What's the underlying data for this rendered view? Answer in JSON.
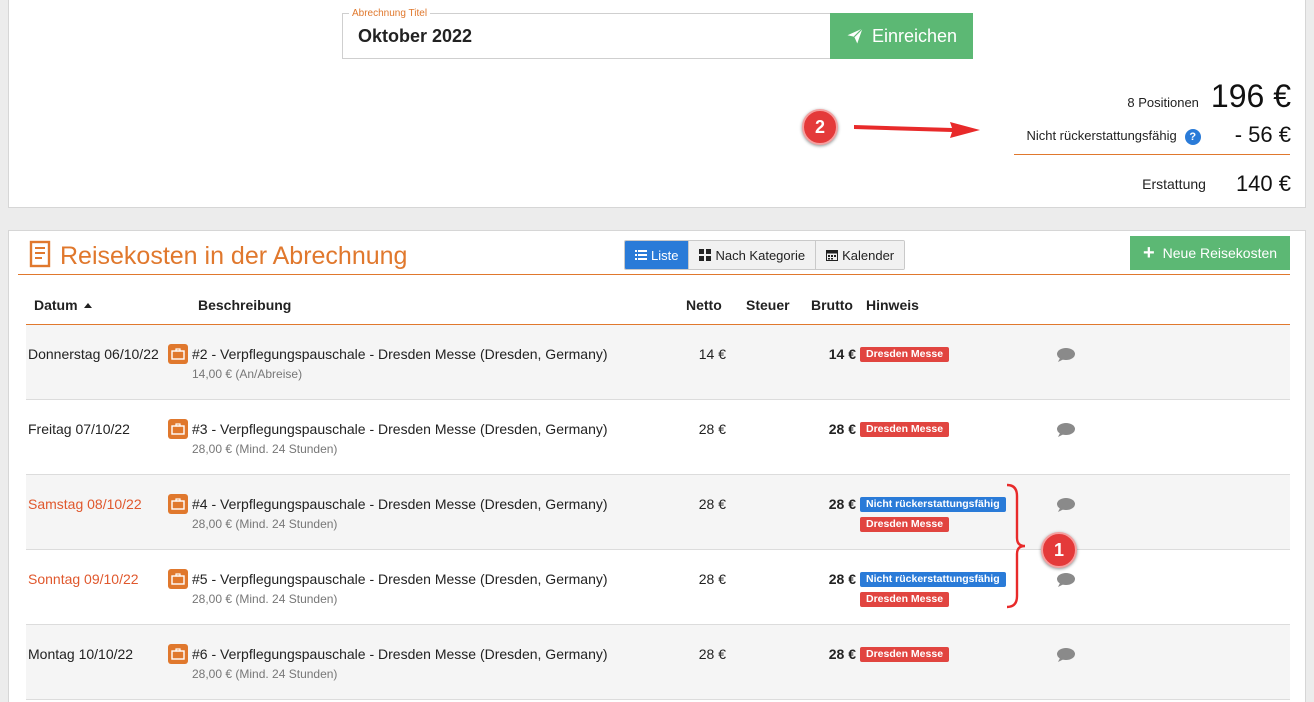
{
  "header": {
    "title_legend": "Abrechnung Titel",
    "title_value": "Oktober 2022",
    "submit_label": "Einreichen"
  },
  "summary": {
    "positions_label": "8 Positionen",
    "total": "196 €",
    "non_refundable_label": "Nicht rückerstattungsfähig",
    "non_refundable_value": "- 56 €",
    "refund_label": "Erstattung",
    "refund_value": "140 €"
  },
  "annotations": {
    "marker1": "1",
    "marker2": "2",
    "color": "#e43a3a"
  },
  "panel": {
    "title": "Reisekosten in der Abrechnung",
    "views": [
      "Liste",
      "Nach Kategorie",
      "Kalender"
    ],
    "active_view": "Liste",
    "new_button": "Neue Reisekosten"
  },
  "table": {
    "columns": {
      "datum": "Datum",
      "beschreibung": "Beschreibung",
      "netto": "Netto",
      "steuer": "Steuer",
      "brutto": "Brutto",
      "hinweis": "Hinweis"
    },
    "rows": [
      {
        "date": "Donnerstag 06/10/22",
        "title": "#2 - Verpflegungspauschale - Dresden Messe (Dresden, Germany)",
        "sub": "14,00 € (An/Abreise)",
        "netto": "14 €",
        "brutto": "14 €",
        "badges": [
          "Dresden Messe"
        ]
      },
      {
        "date": "Freitag 07/10/22",
        "title": "#3 - Verpflegungspauschale - Dresden Messe (Dresden, Germany)",
        "sub": "28,00 € (Mind. 24 Stunden)",
        "netto": "28 €",
        "brutto": "28 €",
        "badges": [
          "Dresden Messe"
        ]
      },
      {
        "date": "Samstag 08/10/22",
        "title": "#4 - Verpflegungspauschale - Dresden Messe (Dresden, Germany)",
        "sub": "28,00 € (Mind. 24 Stunden)",
        "netto": "28 €",
        "brutto": "28 €",
        "badges": [
          "Nicht rückerstattungsfähig",
          "Dresden Messe"
        ]
      },
      {
        "date": "Sonntag 09/10/22",
        "title": "#5 - Verpflegungspauschale - Dresden Messe (Dresden, Germany)",
        "sub": "28,00 € (Mind. 24 Stunden)",
        "netto": "28 €",
        "brutto": "28 €",
        "badges": [
          "Nicht rückerstattungsfähig",
          "Dresden Messe"
        ]
      },
      {
        "date": "Montag 10/10/22",
        "title": "#6 - Verpflegungspauschale - Dresden Messe (Dresden, Germany)",
        "sub": "28,00 € (Mind. 24 Stunden)",
        "netto": "28 €",
        "brutto": "28 €",
        "badges": [
          "Dresden Messe"
        ]
      }
    ]
  },
  "colors": {
    "accent": "#e0782d",
    "green": "#5cb874",
    "blue": "#2a7bd8",
    "red": "#e14540"
  }
}
